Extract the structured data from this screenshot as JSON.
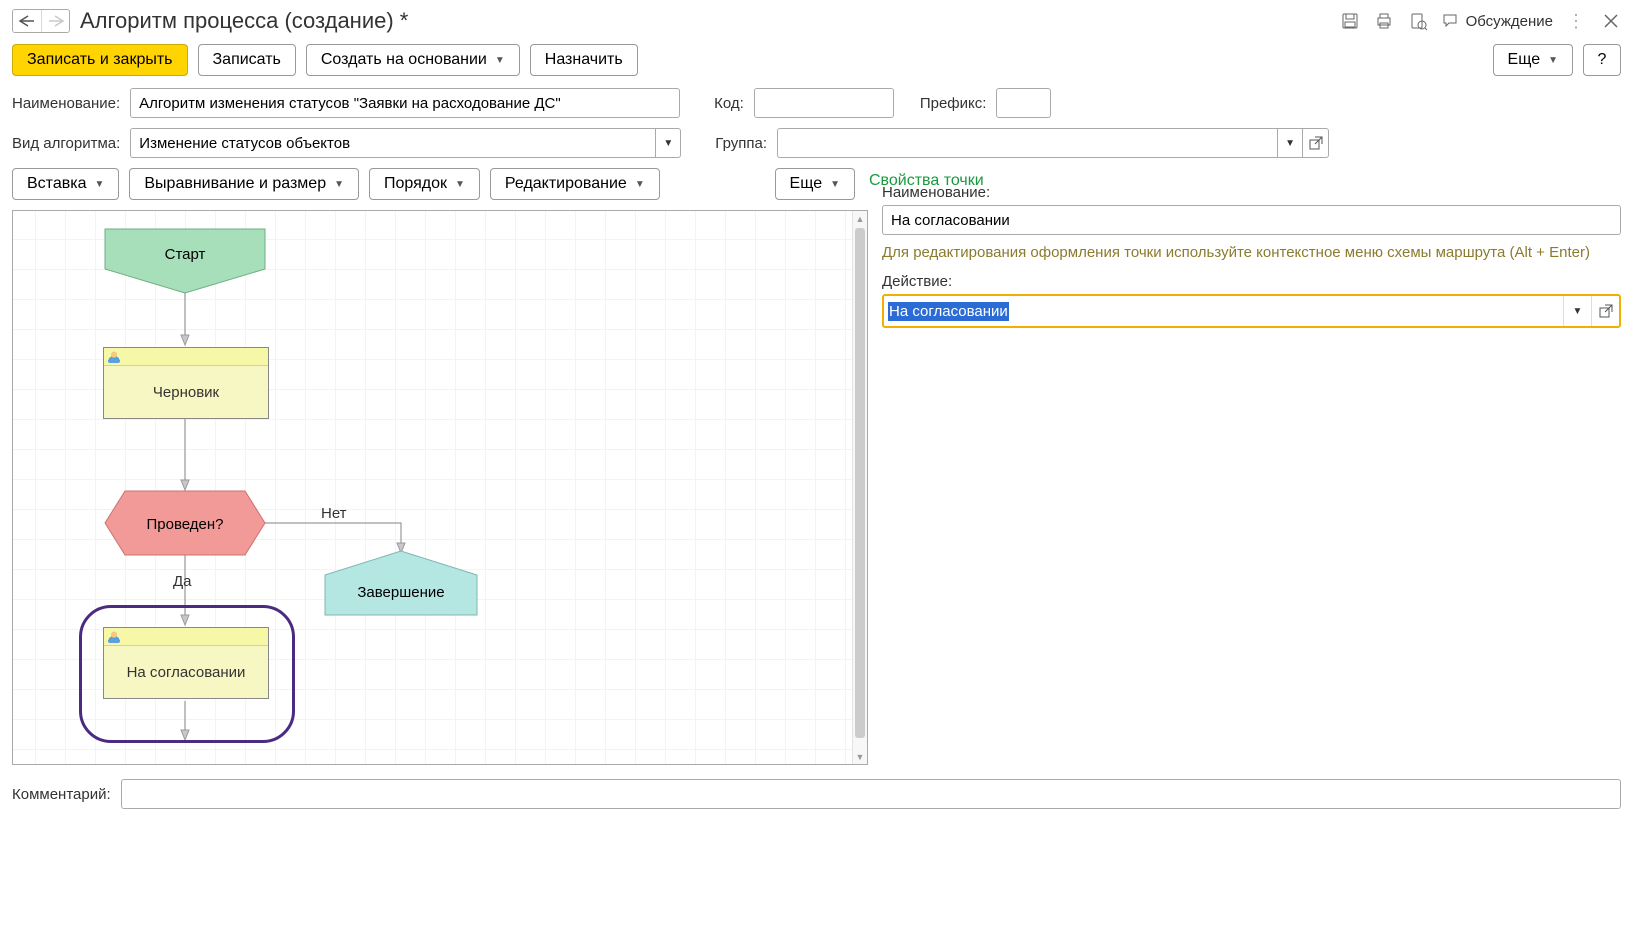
{
  "header": {
    "title": "Алгоритм процесса (создание) *",
    "discuss": "Обсуждение"
  },
  "toolbar": {
    "save_close": "Записать и закрыть",
    "save": "Записать",
    "create_based": "Создать на основании",
    "assign": "Назначить",
    "more": "Еще",
    "help": "?"
  },
  "form": {
    "name_label": "Наименование:",
    "name_value": "Алгоритм изменения статусов \"Заявки на расходование ДС\"",
    "code_label": "Код:",
    "code_value": "",
    "prefix_label": "Префикс:",
    "prefix_value": "",
    "type_label": "Вид алгоритма:",
    "type_value": "Изменение статусов объектов",
    "group_label": "Группа:",
    "group_value": ""
  },
  "editor_tb": {
    "insert": "Вставка",
    "align": "Выравнивание и размер",
    "order": "Порядок",
    "edit": "Редактирование",
    "more": "Еще"
  },
  "diagram": {
    "start": "Старт",
    "draft": "Черновик",
    "decision": "Проведен?",
    "yes": "Да",
    "no": "Нет",
    "approval": "На согласовании",
    "end": "Завершение"
  },
  "props": {
    "title": "Свойства точки",
    "name_label": "Наименование:",
    "name_value": "На согласовании",
    "hint": "Для редактирования оформления точки используйте контекстное меню схемы маршрута (Alt + Enter)",
    "action_label": "Действие:",
    "action_value": "На согласовании"
  },
  "comment": {
    "label": "Комментарий:",
    "value": ""
  }
}
